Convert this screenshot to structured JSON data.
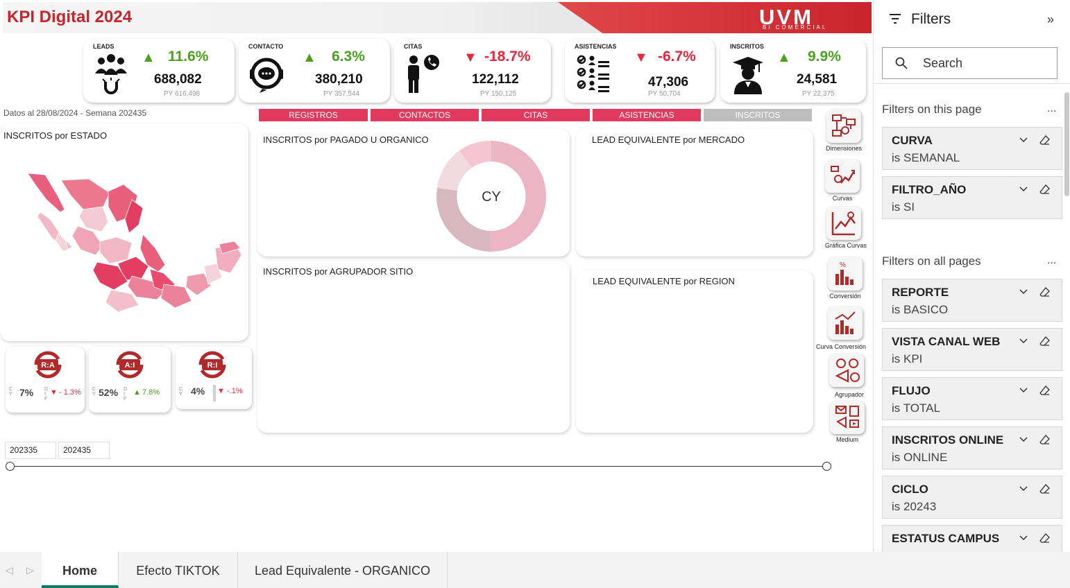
{
  "header": {
    "title": "KPI Digital 2024",
    "logo_text": "UVM",
    "logo_sub": "BI COMERCIAL"
  },
  "kpis": [
    {
      "label": "LEADS",
      "pct": "11.6%",
      "trend": "up",
      "value": "688,082",
      "py": "PY 616,498",
      "icon": "users-magnet-icon"
    },
    {
      "label": "CONTACTO",
      "pct": "6.3%",
      "trend": "up",
      "value": "380,210",
      "py": "PY 357,544",
      "icon": "chat-headset-icon"
    },
    {
      "label": "CITAS",
      "pct": "-18.7%",
      "trend": "down",
      "value": "122,112",
      "py": "PY 150,125",
      "icon": "person-phone-icon"
    },
    {
      "label": "ASISTENCIAS",
      "pct": "-6.7%",
      "trend": "down",
      "value": "47,306",
      "py": "PY 50,704",
      "icon": "attendance-checklist-icon"
    },
    {
      "label": "INSCRITOS",
      "pct": "9.9%",
      "trend": "up",
      "value": "24,581",
      "py": "PY 22,375",
      "icon": "graduate-icon"
    }
  ],
  "date_line": "Datos al 28/08/2024 - Semana 202435",
  "tabs": [
    {
      "label": "REGISTROS",
      "active": true
    },
    {
      "label": "CONTACTOS",
      "active": true
    },
    {
      "label": "CITAS",
      "active": true
    },
    {
      "label": "ASISTENCIAS",
      "active": true
    },
    {
      "label": "INSCRITOS",
      "active": false
    }
  ],
  "panels": {
    "estado": "INSCRITOS por ESTADO",
    "pagado": "INSCRITOS por PAGADO U ORGANICO",
    "donut_label": "CY",
    "mercado": "LEAD EQUIVALENTE por MERCADO",
    "sitio": "INSCRITOS por AGRUPADOR SITIO",
    "region": "LEAD EQUIVALENTE por REGION"
  },
  "ratios": [
    {
      "icon_text": "R:A",
      "cy": "C Y",
      "value": "7%",
      "dif": "D I F",
      "delta": "- 1.3%",
      "trend": "down"
    },
    {
      "icon_text": "A:I",
      "cy": "C Y",
      "value": "52%",
      "dif": "D I F",
      "delta": "7.8%",
      "trend": "up"
    },
    {
      "icon_text": "R:I",
      "cy": "C Y",
      "value": "4%",
      "dif": "",
      "delta": "-.1%",
      "trend": "down"
    }
  ],
  "slicer": {
    "from": "202335",
    "to": "202435"
  },
  "nav_buttons": [
    "Dimensiones",
    "Curvas",
    "Gráfica Curvas",
    "Conversión",
    "Curva Conversión",
    "Agrupador",
    "Medium"
  ],
  "filters": {
    "title": "Filters",
    "search_placeholder": "Search",
    "on_this_page": "Filters on this page",
    "on_all_pages": "Filters on all pages",
    "dots": "...",
    "page_filters": [
      {
        "name": "CURVA",
        "value": "is SEMANAL"
      },
      {
        "name": "FILTRO_AÑO",
        "value": "is SI"
      }
    ],
    "all_filters": [
      {
        "name": "REPORTE",
        "value": "is BASICO"
      },
      {
        "name": "VISTA CANAL WEB",
        "value": "is KPI"
      },
      {
        "name": "FLUJO",
        "value": "is TOTAL"
      },
      {
        "name": "INSCRITOS ONLINE",
        "value": "is ONLINE"
      },
      {
        "name": "CICLO",
        "value": "is 20243"
      },
      {
        "name": "ESTATUS CAMPUS",
        "value": ""
      }
    ]
  },
  "page_tabs": [
    {
      "label": "Home",
      "active": true
    },
    {
      "label": "Efecto TIKTOK",
      "active": false
    },
    {
      "label": "Lead Equivalente - ORGANICO",
      "active": false
    }
  ],
  "colors": {
    "brand_red": "#c8242c",
    "tab_pink": "#e13a5e",
    "up_green": "#4aa11e",
    "down_red": "#e8253a",
    "active_tab": "#117865"
  }
}
